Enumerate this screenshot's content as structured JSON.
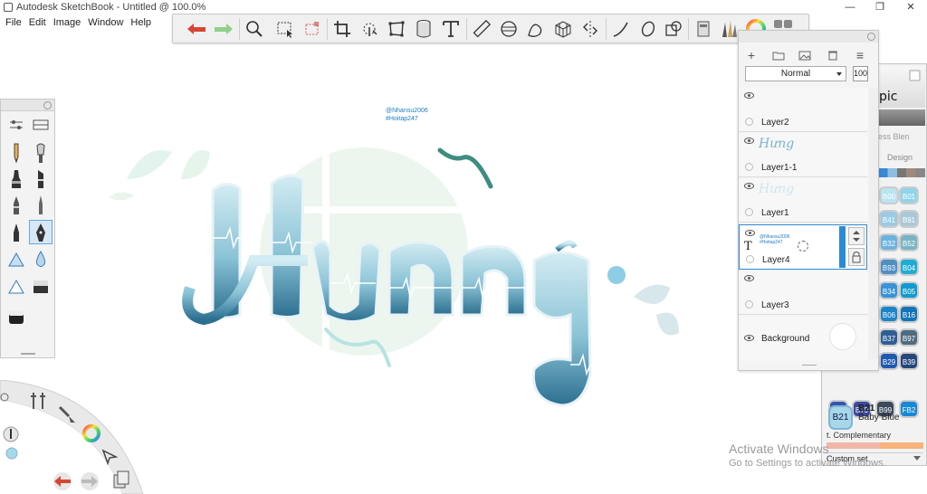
{
  "window": {
    "title": "Autodesk SketchBook - Untitled @ 100.0%",
    "controls": {
      "minimize": "—",
      "maximize": "❐",
      "close": "✕"
    }
  },
  "menu": [
    "File",
    "Edit",
    "Image",
    "Window",
    "Help"
  ],
  "canvas": {
    "watermark_line1": "@Nhansu2006",
    "watermark_line2": "#Hoitap247",
    "lettering": "Hưng"
  },
  "layers": {
    "blend_mode": "Normal",
    "opacity": "100",
    "items": [
      {
        "name": "Layer2",
        "thumb": ""
      },
      {
        "name": "Layer1-1",
        "thumb": "Hưng"
      },
      {
        "name": "Layer1",
        "thumb": "Hưng"
      },
      {
        "name": "Layer4",
        "thumb_line1": "@Nhansu2006",
        "thumb_line2": "#Hoitap247",
        "selected": true
      },
      {
        "name": "Layer3",
        "thumb": ""
      },
      {
        "name": "Background",
        "thumb": ""
      }
    ]
  },
  "copic": {
    "logo_text": "pic",
    "less_blend": "ess Blen",
    "tab_design": "Design",
    "swatches": [
      {
        "code": "B00",
        "color": "#b9e4f0"
      },
      {
        "code": "B01",
        "color": "#8fd5ea"
      },
      {
        "code": "B41",
        "color": "#98cbe4"
      },
      {
        "code": "B91",
        "color": "#a9c9d9"
      },
      {
        "code": "B32",
        "color": "#6ab3df"
      },
      {
        "code": "B52",
        "color": "#7ab4c4"
      },
      {
        "code": "B93",
        "color": "#4d90c4"
      },
      {
        "code": "B04",
        "color": "#1dacd6"
      },
      {
        "code": "B34",
        "color": "#3894d6"
      },
      {
        "code": "B05",
        "color": "#129ad0"
      },
      {
        "code": "B06",
        "color": "#1c84c8"
      },
      {
        "code": "B16",
        "color": "#1474b8"
      },
      {
        "code": "B37",
        "color": "#2e5e93"
      },
      {
        "code": "B97",
        "color": "#4f6b80"
      },
      {
        "code": "B29",
        "color": "#1f59b0"
      },
      {
        "code": "B39",
        "color": "#26477a"
      },
      {
        "code": "B69",
        "color": "#3357b0"
      },
      {
        "code": "B79",
        "color": "#3c4a9e"
      },
      {
        "code": "B99",
        "color": "#3d4a5c"
      },
      {
        "code": "FB2",
        "color": "#1689d6"
      }
    ],
    "selected_code": "B21",
    "selected_name": "Baby Blue",
    "selected_color": "#a6d8ea",
    "complementary_label": "t. Complementary",
    "custom_set": "Custom set"
  },
  "activate": {
    "line1": "Activate Windows",
    "line2": "Go to Settings to activate Windows."
  },
  "colors": {
    "accent": "#2b8ad6",
    "lettering_light": "#bfe3ee",
    "lettering_dark": "#2f6f8f",
    "blob": "#eaf5ec"
  }
}
